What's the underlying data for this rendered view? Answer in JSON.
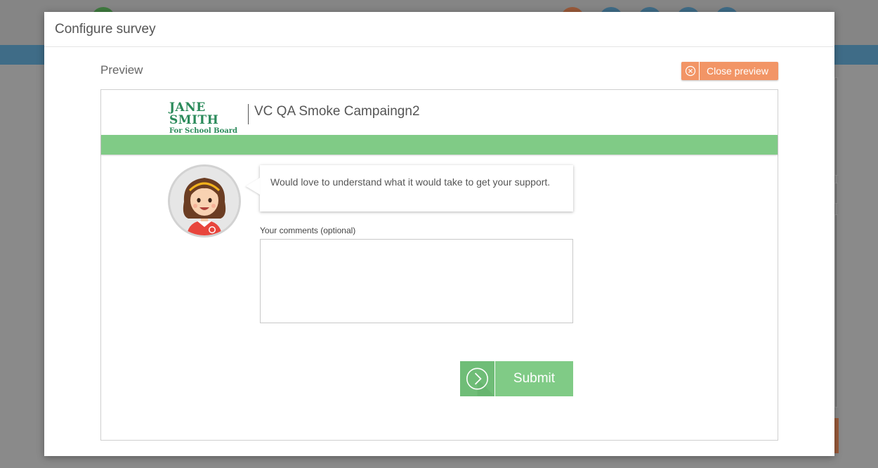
{
  "modal": {
    "title": "Configure survey"
  },
  "preview": {
    "label": "Preview",
    "close_button": "Close preview"
  },
  "survey": {
    "logo": {
      "name": "JANE SMITH",
      "sub": "For School Board"
    },
    "campaign_name": "VC QA Smoke Campaingn2",
    "question": "Would love to understand what it would take to get your support.",
    "comments_label": "Your comments (optional)",
    "comments_value": "",
    "submit_label": "Submit"
  },
  "colors": {
    "accent_green": "#80cb86",
    "close_orange": "#f29566",
    "brand_green": "#2a8a5a"
  }
}
